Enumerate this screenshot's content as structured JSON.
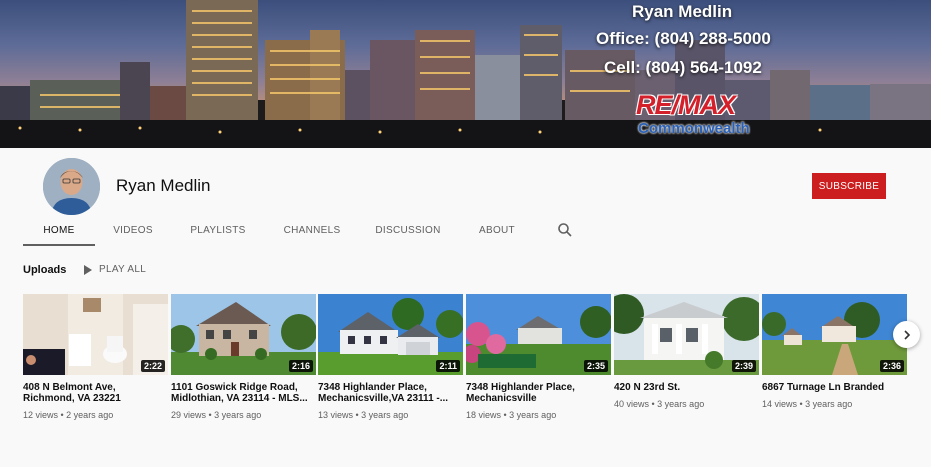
{
  "banner": {
    "name": "Ryan Medlin",
    "office": "Office: (804) 288-5000",
    "cell": "Cell: (804) 564-1092",
    "brand_logo": "RE/MAX",
    "brand_sub": "Commonwealth",
    "colors": {
      "brand_red": "#d3202b",
      "brand_blue": "#2a60b5"
    }
  },
  "channel": {
    "name": "Ryan Medlin",
    "subscribe_label": "SUBSCRIBE",
    "subscribe_color": "#cc1e1e"
  },
  "tabs": [
    {
      "label": "HOME",
      "active": true
    },
    {
      "label": "VIDEOS",
      "active": false
    },
    {
      "label": "PLAYLISTS",
      "active": false
    },
    {
      "label": "CHANNELS",
      "active": false
    },
    {
      "label": "DISCUSSION",
      "active": false
    },
    {
      "label": "ABOUT",
      "active": false
    }
  ],
  "tab_search_icon": "search-icon",
  "uploads": {
    "label": "Uploads",
    "play_all": "PLAY ALL",
    "videos": [
      {
        "title": "408 N Belmont Ave, Richmond, VA 23221",
        "duration": "2:22",
        "views": "12 views",
        "age": "2 years ago"
      },
      {
        "title": "1101 Goswick Ridge Road, Midlothian, VA 23114 - MLS...",
        "duration": "2:16",
        "views": "29 views",
        "age": "3 years ago"
      },
      {
        "title": "7348 Highlander Place, Mechanicsville,VA 23111 -...",
        "duration": "2:11",
        "views": "13 views",
        "age": "3 years ago"
      },
      {
        "title": "7348 Highlander Place, Mechanicsville",
        "duration": "2:35",
        "views": "18 views",
        "age": "3 years ago"
      },
      {
        "title": "420 N 23rd St.",
        "duration": "2:39",
        "views": "40 views",
        "age": "3 years ago"
      },
      {
        "title": "6867 Turnage Ln Branded",
        "duration": "2:36",
        "views": "14 views",
        "age": "3 years ago"
      }
    ]
  },
  "next_icon": "chevron-right-icon"
}
